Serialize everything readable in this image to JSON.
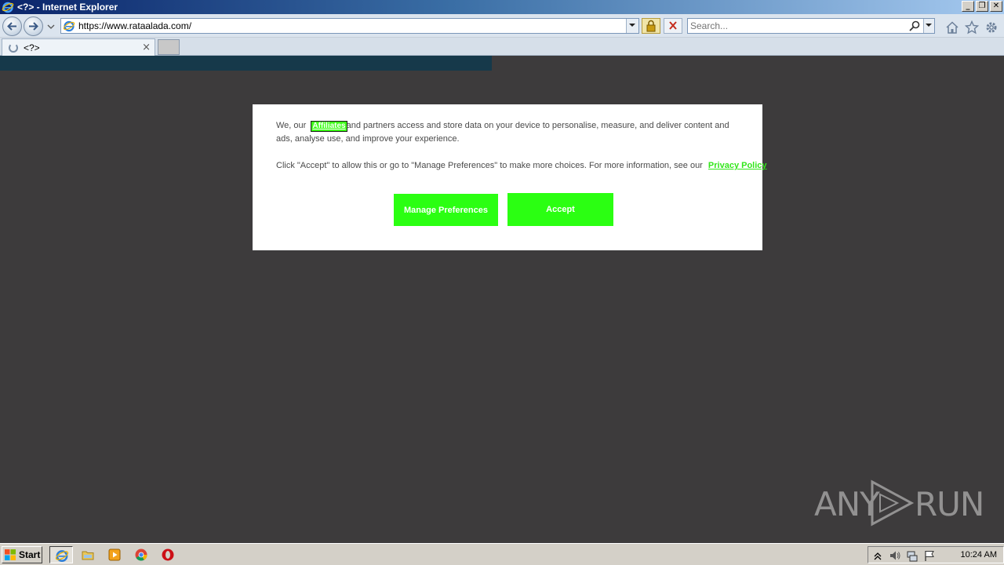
{
  "window": {
    "title": "<?> - Internet Explorer",
    "minimize_label": "_",
    "restore_label": "❐",
    "close_label": "✕"
  },
  "navbar": {
    "url": "https://www.rataalada.com/",
    "search_placeholder": "Search..."
  },
  "tabs": [
    {
      "title": "<?>",
      "close_label": "×"
    }
  ],
  "consent": {
    "text1_prefix": "We, our",
    "affiliates_link": "Affiliates",
    "text1_suffix": "and partners access and store data on your device to personalise, measure, and deliver content and ads, analyse use, and improve your experience.",
    "text2": "Click \"Accept\" to allow this or go to \"Manage Preferences\" to make more choices. For more information, see our",
    "privacy_link": "Privacy Policy",
    "manage_label": "Manage Preferences",
    "accept_label": "Accept",
    "accent_color": "#2bff12"
  },
  "watermark": {
    "left_text": "ANY",
    "right_text": "RUN"
  },
  "taskbar": {
    "start_label": "Start",
    "apps": [
      "internet-explorer-icon",
      "file-explorer-icon",
      "media-player-icon",
      "chrome-icon",
      "opera-icon"
    ],
    "clock": "10:24 AM"
  }
}
